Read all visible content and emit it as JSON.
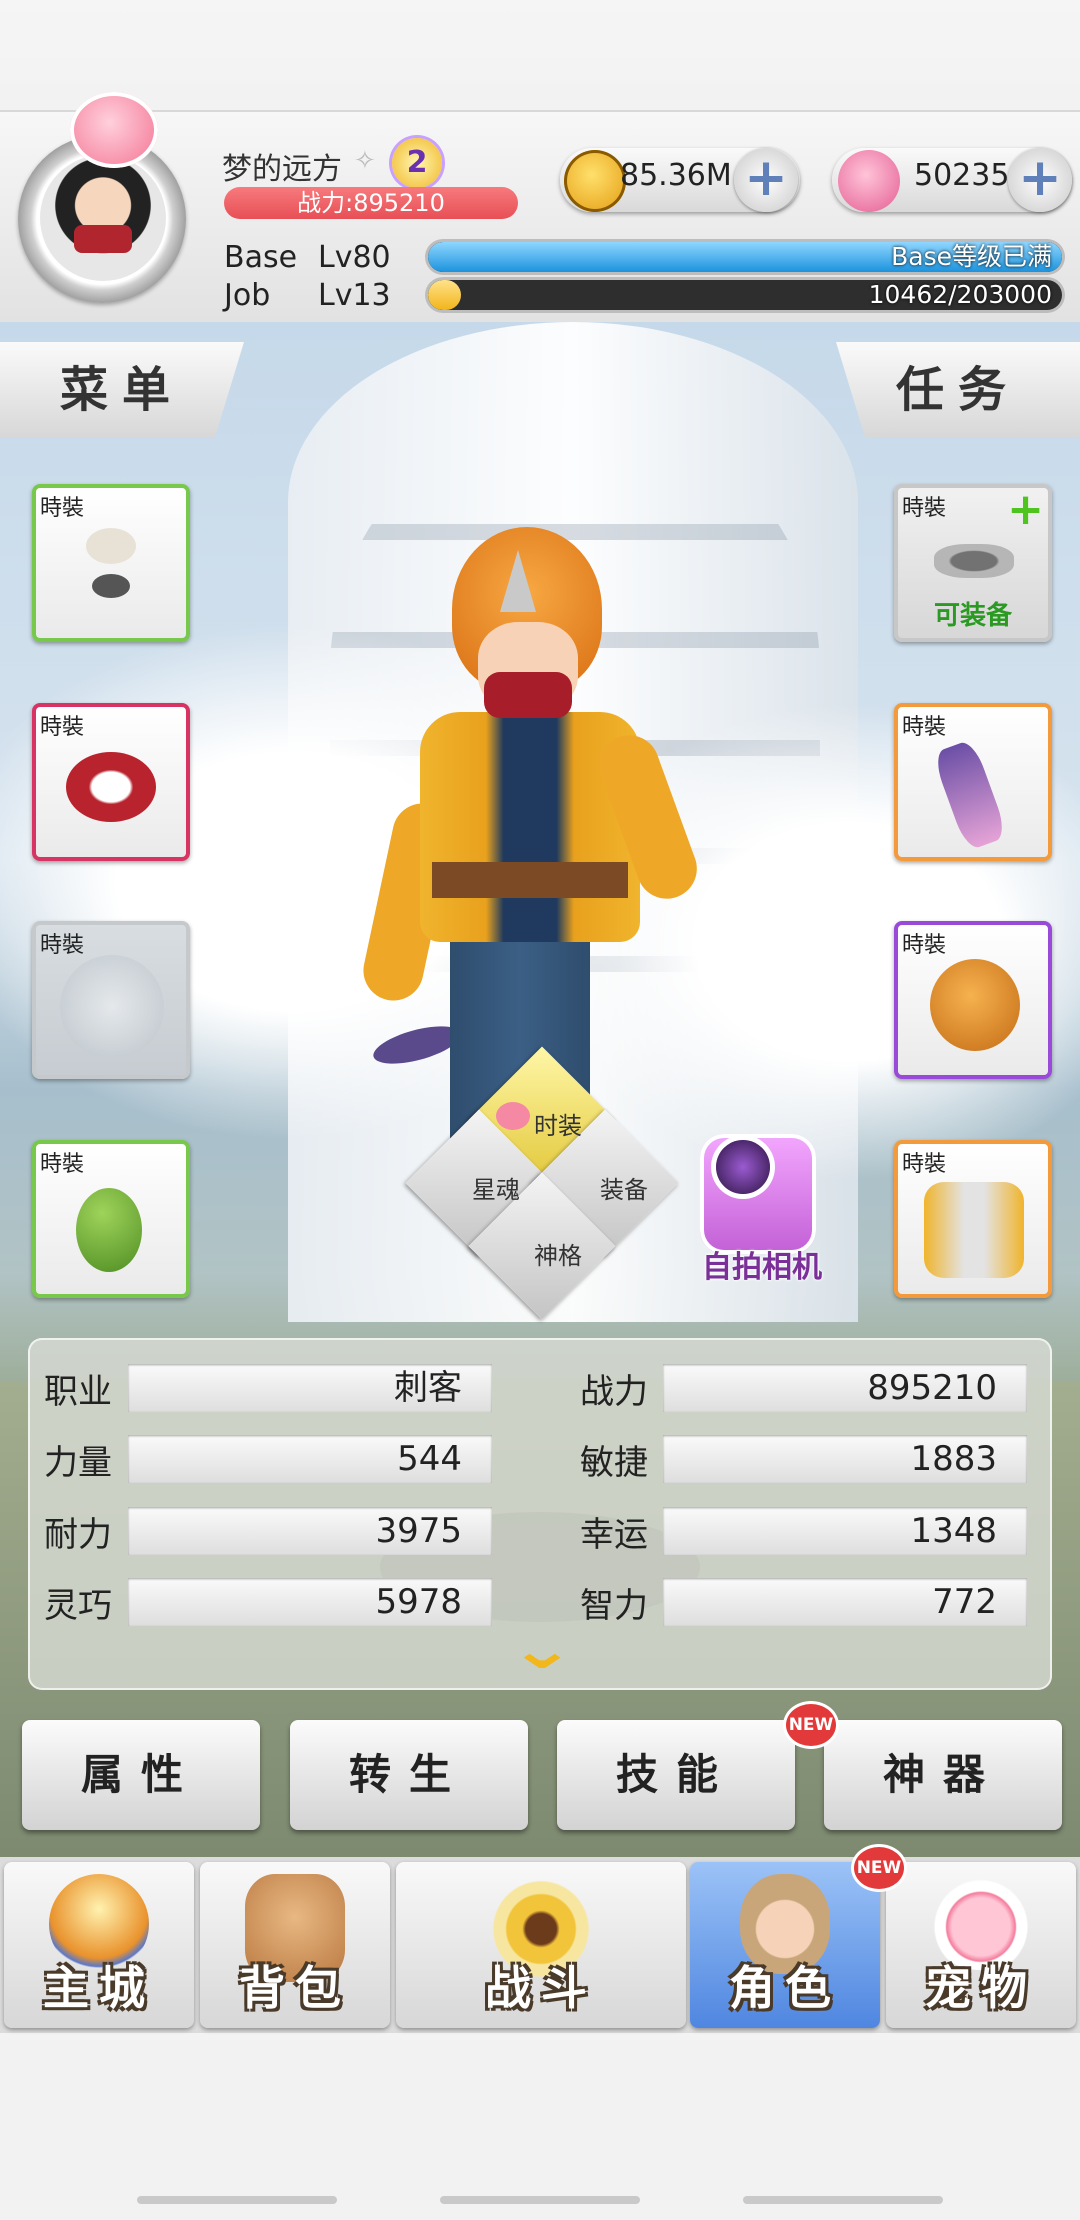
{
  "player": {
    "name": "梦的远方",
    "vip_level": "2",
    "power_label": "战力:895210",
    "base_label": "Base",
    "base_level": "Lv80",
    "base_exp_text": "Base等级已满",
    "base_exp_fraction": 1.0,
    "job_label": "Job",
    "job_level": "Lv13",
    "job_exp_text": "10462/203000",
    "job_exp_fraction": 0.0515
  },
  "currency": {
    "gold": "85.36M",
    "gems": "50235"
  },
  "tabs": {
    "menu": "菜单",
    "task": "任务"
  },
  "slots": {
    "label": "時裝",
    "r1_caption": "可装备"
  },
  "wheel": {
    "fashion": "时装",
    "soul": "星魂",
    "equip": "装备",
    "divine": "神格"
  },
  "camera": {
    "label": "自拍相机"
  },
  "stats": {
    "job_label": "职业",
    "job_value": "刺客",
    "power_label": "战力",
    "power_value": "895210",
    "str_label": "力量",
    "str_value": "544",
    "agi_label": "敏捷",
    "agi_value": "1883",
    "vit_label": "耐力",
    "vit_value": "3975",
    "luk_label": "幸运",
    "luk_value": "1348",
    "dex_label": "灵巧",
    "dex_value": "5978",
    "int_label": "智力",
    "int_value": "772"
  },
  "buttons": {
    "attributes": "属性",
    "rebirth": "转生",
    "skills": "技能",
    "artifact": "神器",
    "new_badge": "NEW"
  },
  "nav": {
    "home": "主城",
    "bag": "背包",
    "battle": "战斗",
    "role": "角色",
    "pet": "宠物",
    "active": "role"
  },
  "colors": {
    "power_bar": "#e74f55",
    "base_exp": "#1c93dd",
    "job_exp": "#f2b51a",
    "active_nav": "#4f86e0"
  }
}
